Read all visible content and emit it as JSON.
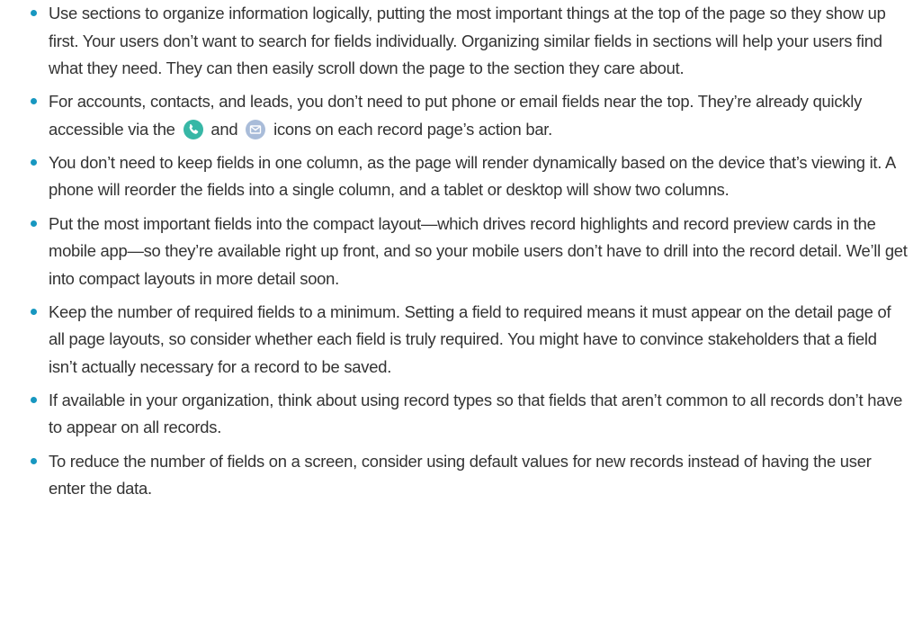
{
  "colors": {
    "bullet": "#1797c0",
    "text": "#333333",
    "phone_icon": "#37b7a6",
    "email_icon": "#a9bcd9"
  },
  "bullets": [
    {
      "text": "Use sections to organize information logically, putting the most important things at the top of the page so they show up first. Your users don’t want to search for fields individually. Organizing similar fields in sections will help your users find what they need. They can then easily scroll down the page to the section they care about."
    },
    {
      "text_a": "For accounts, contacts, and leads, you don’t need to put phone or email fields near the top. They’re already quickly accessible via the",
      "text_b": "and",
      "text_c": "icons on each record page’s action bar.",
      "icons": [
        "phone-icon",
        "email-icon"
      ]
    },
    {
      "text": "You don’t need to keep fields in one column, as the page will render dynamically based on the device that’s viewing it. A phone will reorder the fields into a single column, and a tablet or desktop will show two columns."
    },
    {
      "text": "Put the most important fields into the compact layout—which drives record highlights and record preview cards in the mobile app—so they’re available right up front, and so your mobile users don’t have to drill into the record detail. We’ll get into compact layouts in more detail soon."
    },
    {
      "text": "Keep the number of required fields to a minimum. Setting a field to required means it must appear on the detail page of all page layouts, so consider whether each field is truly required. You might have to convince stakeholders that a field isn’t actually necessary for a record to be saved."
    },
    {
      "text": "If available in your organization, think about using record types so that fields that aren’t common to all records don’t have to appear on all records."
    },
    {
      "text": "To reduce the number of fields on a screen, consider using default values for new records instead of having the user enter the data."
    }
  ]
}
